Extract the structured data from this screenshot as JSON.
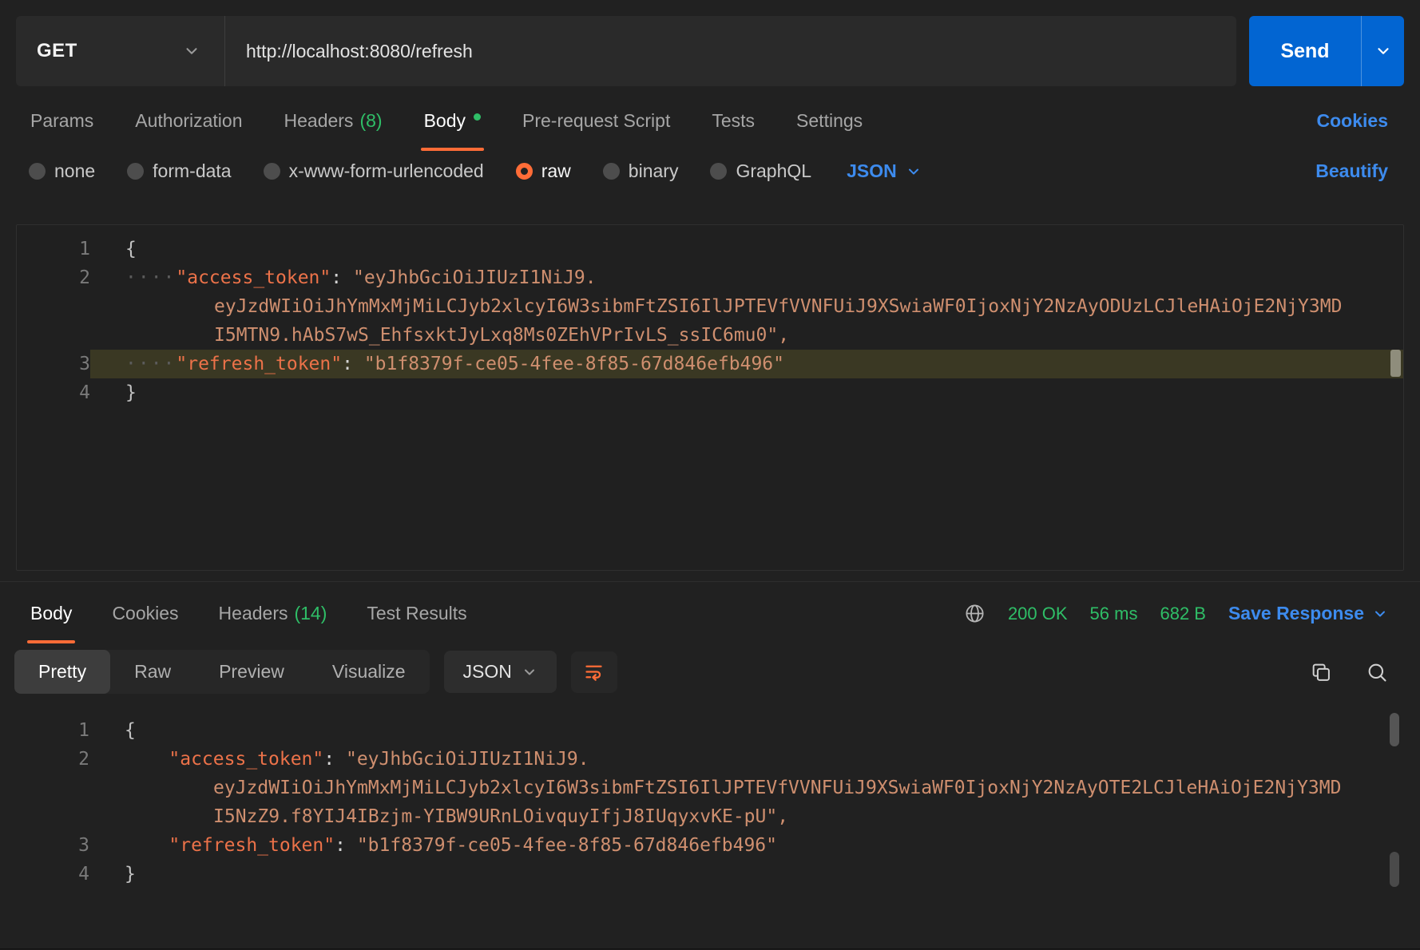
{
  "colors": {
    "accent_orange": "#ff6c37",
    "link_blue": "#3d8bee",
    "send_blue": "#0265d2",
    "success_green": "#2fbe67"
  },
  "request": {
    "method": "GET",
    "url": "http://localhost:8080/refresh",
    "send_label": "Send"
  },
  "request_tabs": {
    "params": "Params",
    "authorization": "Authorization",
    "headers": "Headers",
    "headers_count": "(8)",
    "body": "Body",
    "pre_request": "Pre-request Script",
    "tests": "Tests",
    "settings": "Settings",
    "cookies_link": "Cookies"
  },
  "body_options": {
    "none": "none",
    "form_data": "form-data",
    "urlencoded": "x-www-form-urlencoded",
    "raw": "raw",
    "binary": "binary",
    "graphql": "GraphQL",
    "format": "JSON",
    "beautify_link": "Beautify"
  },
  "request_editor": {
    "indent_dots": "····",
    "l1": {
      "num": "1",
      "text": "{"
    },
    "l2": {
      "num": "2",
      "key": "\"access_token\"",
      "sep": ": ",
      "v1": "\"eyJhbGciOiJIUzI1NiJ9.",
      "v2": "eyJzdWIiOiJhYmMxMjMiLCJyb2xlcyI6W3sibmFtZSI6IlJPTEVfVVNFUiJ9XSwiaWF0IjoxNjY2NzAyODUzLCJleHAiOjE2NjY3MD",
      "v3": "I5MTN9.hAbS7wS_EhfsxktJyLxq8Ms0ZEhVPrIvLS_ssIC6mu0\","
    },
    "l3": {
      "num": "3",
      "key": "\"refresh_token\"",
      "sep": ": ",
      "value": "\"b1f8379f-ce05-4fee-8f85-67d846efb496\""
    },
    "l4": {
      "num": "4",
      "text": "}"
    }
  },
  "response_tabs": {
    "body": "Body",
    "cookies": "Cookies",
    "headers": "Headers",
    "headers_count": "(14)",
    "test_results": "Test Results"
  },
  "response_meta": {
    "status": "200 OK",
    "time": "56 ms",
    "size": "682 B",
    "save_label": "Save Response"
  },
  "response_toolbar": {
    "pretty": "Pretty",
    "raw": "Raw",
    "preview": "Preview",
    "visualize": "Visualize",
    "format": "JSON"
  },
  "response_editor": {
    "indent": "    ",
    "l1": {
      "num": "1",
      "text": "{"
    },
    "l2": {
      "num": "2",
      "key": "\"access_token\"",
      "sep": ": ",
      "v1": "\"eyJhbGciOiJIUzI1NiJ9.",
      "v2": "eyJzdWIiOiJhYmMxMjMiLCJyb2xlcyI6W3sibmFtZSI6IlJPTEVfVVNFUiJ9XSwiaWF0IjoxNjY2NzAyOTE2LCJleHAiOjE2NjY3MD",
      "v3": "I5NzZ9.f8YIJ4IBzjm-YIBW9URnLOivquyIfjJ8IUqyxvKE-pU\","
    },
    "l3": {
      "num": "3",
      "key": "\"refresh_token\"",
      "sep": ": ",
      "value": "\"b1f8379f-ce05-4fee-8f85-67d846efb496\""
    },
    "l4": {
      "num": "4",
      "text": "}"
    }
  }
}
